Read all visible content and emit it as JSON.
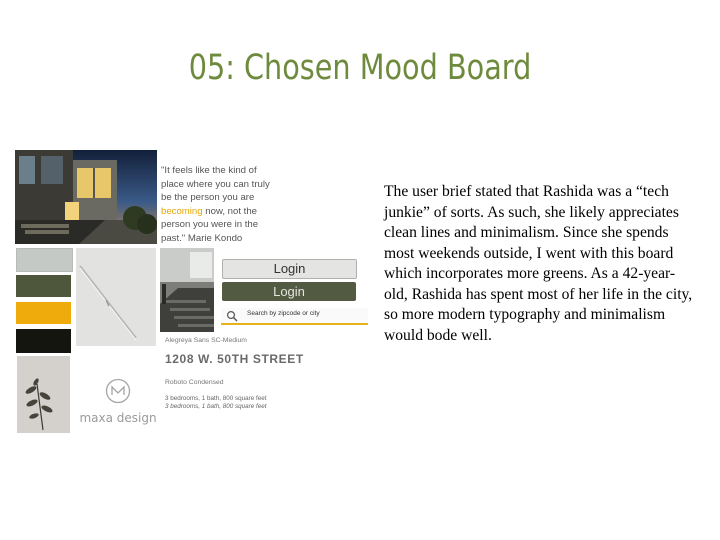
{
  "slide": {
    "title": "05: Chosen Mood Board",
    "body": "The user brief stated that Rashida was a “tech junkie” of sorts. As such, she likely appreciates clean lines and minimalism. Since she spends most weekends outside, I went with this board which incorporates more greens.  As a 42-year-old, Rashida has spent most of her life in the city, so more modern typography and minimalism would bode well."
  },
  "colors": {
    "title": "#6e8b3d",
    "swatches": [
      "#c5c9c5",
      "#4e573c",
      "#efab0b",
      "#151510"
    ]
  },
  "moodboard": {
    "quote": {
      "before": "\"It feels like the kind of place where you can truly be the person you are",
      "highlight": "becoming",
      "after": "now, not the person you were in the past.\" Marie Kondo"
    },
    "login_light_label": "Login",
    "login_dark_label": "Login",
    "search_placeholder": "Search by zipcode or city",
    "font_sample_1": "Alegreya Sans SC-Medium",
    "address": "1208 W. 50TH STREET",
    "font_sample_2": "Roboto Condensed",
    "spec_regular": "3 bedrooms, 1 bath, 800 square feet",
    "spec_italic": "3 bedrooms, 1 bath, 800 square feet",
    "logo_text": "maxa design"
  }
}
